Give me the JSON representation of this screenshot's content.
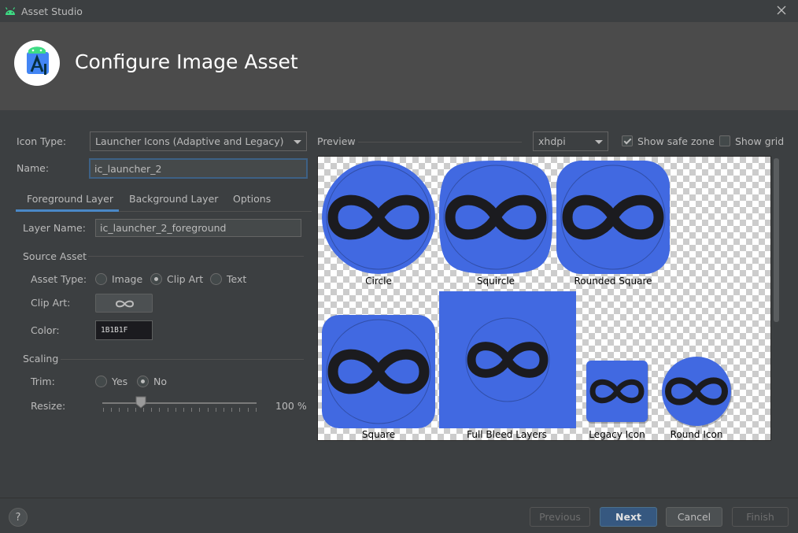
{
  "window": {
    "title": "Asset Studio"
  },
  "header": {
    "title": "Configure Image Asset"
  },
  "form": {
    "icon_type_label": "Icon Type:",
    "icon_type_value": "Launcher Icons (Adaptive and Legacy)",
    "name_label": "Name:",
    "name_value": "ic_launcher_2"
  },
  "tabs": [
    {
      "label": "Foreground Layer",
      "selected": true
    },
    {
      "label": "Background Layer",
      "selected": false
    },
    {
      "label": "Options",
      "selected": false
    }
  ],
  "foreground": {
    "layer_name_label": "Layer Name:",
    "layer_name_value": "ic_launcher_2_foreground",
    "source_asset_title": "Source Asset",
    "asset_type_label": "Asset Type:",
    "asset_type_options": [
      {
        "label": "Image",
        "checked": false
      },
      {
        "label": "Clip Art",
        "checked": true
      },
      {
        "label": "Text",
        "checked": false
      }
    ],
    "clip_art_label": "Clip Art:",
    "clip_art_icon": "all-inclusive-icon",
    "color_label": "Color:",
    "color_value": "1B1B1F",
    "scaling_title": "Scaling",
    "trim_label": "Trim:",
    "trim_options": [
      {
        "label": "Yes",
        "checked": false
      },
      {
        "label": "No",
        "checked": true
      }
    ],
    "resize_label": "Resize:",
    "resize_value": "100 %",
    "resize_fraction": 0.25
  },
  "preview": {
    "label": "Preview",
    "density": "xhdpi",
    "show_safe_zone_label": "Show safe zone",
    "show_safe_zone": true,
    "show_grid_label": "Show grid",
    "show_grid": false,
    "icons": [
      {
        "label": "Circle",
        "shape": "circle"
      },
      {
        "label": "Squircle",
        "shape": "squircle"
      },
      {
        "label": "Rounded Square",
        "shape": "rounded-square"
      },
      {
        "label": "Square",
        "shape": "square"
      },
      {
        "label": "Full Bleed Layers",
        "shape": "full-bleed"
      },
      {
        "label": "Legacy Icon",
        "shape": "legacy"
      },
      {
        "label": "Round Icon",
        "shape": "round"
      }
    ],
    "icon_color": "#4169e1",
    "glyph_color": "#1b1b1f"
  },
  "footer": {
    "help_label": "?",
    "previous_label": "Previous",
    "next_label": "Next",
    "cancel_label": "Cancel",
    "finish_label": "Finish"
  }
}
